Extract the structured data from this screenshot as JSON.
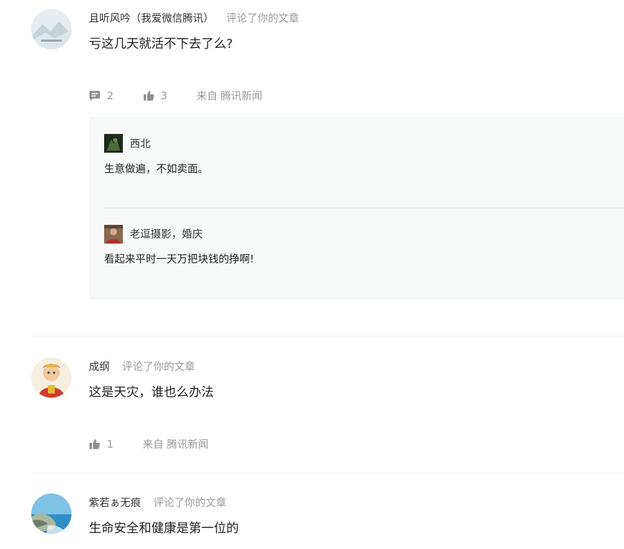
{
  "comments": [
    {
      "username": "且听风吟（我爱微信腾讯）",
      "action": "评论了你的文章",
      "text": "亏这几天就活不下去了么?",
      "reply_count": "2",
      "like_count": "3",
      "source": "来自 腾讯新闻",
      "replies": [
        {
          "username": "西北",
          "text": "生意做遍，不如卖面。"
        },
        {
          "username": "老逗摄影，婚庆",
          "text": "看起来平时一天万把块钱的挣啊!"
        }
      ]
    },
    {
      "username": "成纲",
      "action": "评论了你的文章",
      "text": "这是天灾，谁也么办法",
      "like_count": "1",
      "source": "来自 腾讯新闻"
    },
    {
      "username": "紫若ぁ无痕",
      "action": "评论了你的文章",
      "text": "生命安全和健康是第一位的"
    }
  ],
  "colors": {
    "muted_text": "#999999",
    "reply_background": "#f7f8f8",
    "divider": "#ececec"
  },
  "icons": [
    "comment-icon",
    "thumbs-up-icon"
  ]
}
